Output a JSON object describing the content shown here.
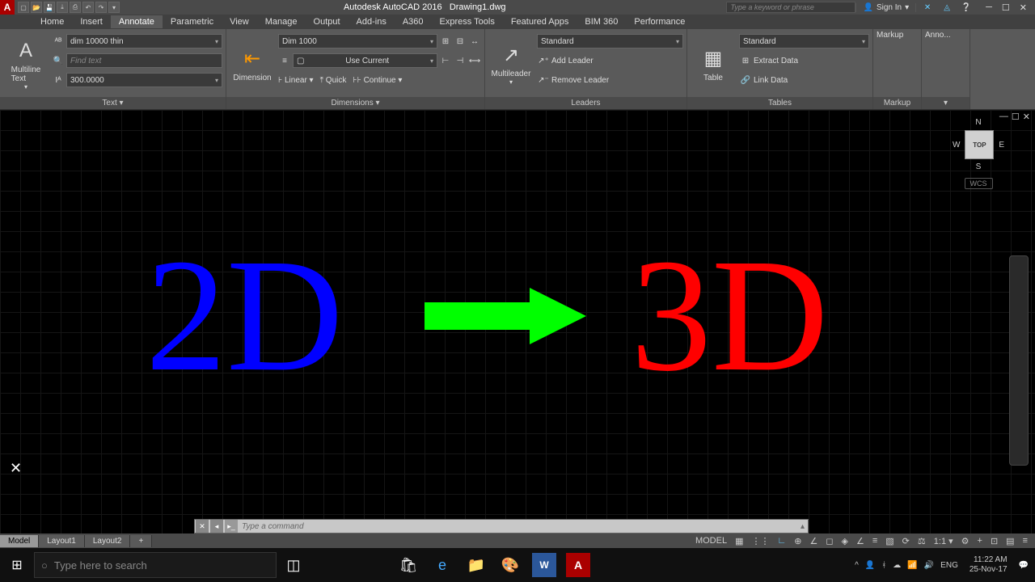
{
  "title": {
    "app": "Autodesk AutoCAD 2016",
    "file": "Drawing1.dwg"
  },
  "qat_icons": [
    "new",
    "open",
    "save",
    "saveall",
    "plot",
    "undo",
    "redo"
  ],
  "search_placeholder": "Type a keyword or phrase",
  "signin": "Sign In",
  "ribbon_tabs": [
    "Home",
    "Insert",
    "Annotate",
    "Parametric",
    "View",
    "Manage",
    "Output",
    "Add-ins",
    "A360",
    "Express Tools",
    "Featured Apps",
    "BIM 360",
    "Performance"
  ],
  "active_tab": "Annotate",
  "panels": {
    "text": {
      "label": "Text ▾",
      "big": "Multiline\nText",
      "style": "dim 10000 thin",
      "find": "Find text",
      "height": "300.0000"
    },
    "dimensions": {
      "label": "Dimensions ▾",
      "big": "Dimension",
      "style": "Dim 1000",
      "use_current": "Use Current",
      "linear": "Linear ▾",
      "quick": "Quick",
      "continue": "Continue ▾"
    },
    "leaders": {
      "label": "Leaders",
      "big": "Multileader",
      "style": "Standard",
      "add": "Add Leader",
      "remove": "Remove Leader"
    },
    "tables": {
      "label": "Tables",
      "big": "Table",
      "style": "Standard",
      "extract": "Extract Data",
      "link": "Link Data"
    },
    "markup": "Markup",
    "anno": "Anno..."
  },
  "canvas": {
    "text2d": "2D",
    "text3d": "3D",
    "viewcube": {
      "n": "N",
      "s": "S",
      "e": "E",
      "w": "W",
      "top": "TOP"
    },
    "wcs": "WCS"
  },
  "cmdline": {
    "placeholder": "Type a command"
  },
  "layout_tabs": [
    "Model",
    "Layout1",
    "Layout2"
  ],
  "statusbar": {
    "model": "MODEL",
    "scale": "1:1 ▾"
  },
  "taskbar": {
    "search": "Type here to search",
    "lang": "ENG",
    "time": "11:22 AM",
    "date": "25-Nov-17"
  }
}
